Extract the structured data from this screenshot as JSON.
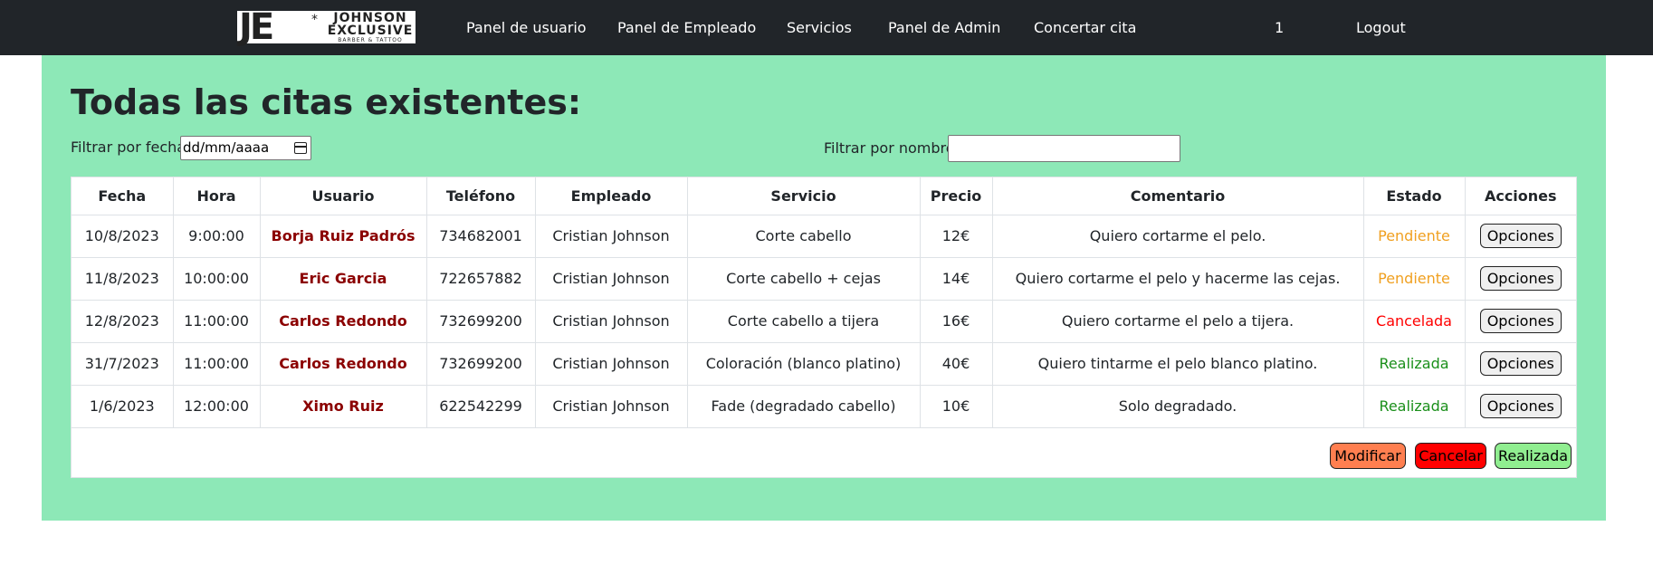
{
  "nav": {
    "logo_mark": "JE",
    "logo_star": "*",
    "logo_line1": "JOHNSON",
    "logo_line2": "EXCLUSIVE",
    "logo_line3": "BARBER & TATTOO",
    "links": [
      "Panel de usuario",
      "Panel de Empleado",
      "Servicios",
      "Panel de Admin",
      "Concertar cita"
    ],
    "user_id": "1",
    "logout": "Logout"
  },
  "page": {
    "title": "Todas las citas existentes:",
    "filter_date_label": "Filtrar por fecha:",
    "filter_date_value": "dd/mm/aaaa",
    "filter_name_label": "Filtrar por nombre:",
    "filter_name_value": ""
  },
  "table": {
    "headers": [
      "Fecha",
      "Hora",
      "Usuario",
      "Teléfono",
      "Empleado",
      "Servicio",
      "Precio",
      "Comentario",
      "Estado",
      "Acciones"
    ],
    "rows": [
      {
        "fecha": "10/8/2023",
        "hora": "9:00:00",
        "usuario": "Borja Ruiz Padrós",
        "telefono": "734682001",
        "empleado": "Cristian Johnson",
        "servicio": "Corte cabello",
        "precio": "12€",
        "comentario": "Quiero cortarme el pelo.",
        "estado": "Pendiente",
        "accion": "Opciones"
      },
      {
        "fecha": "11/8/2023",
        "hora": "10:00:00",
        "usuario": "Eric Garcia",
        "telefono": "722657882",
        "empleado": "Cristian Johnson",
        "servicio": "Corte cabello + cejas",
        "precio": "14€",
        "comentario": "Quiero cortarme el pelo y hacerme las cejas.",
        "estado": "Pendiente",
        "accion": "Opciones"
      },
      {
        "fecha": "12/8/2023",
        "hora": "11:00:00",
        "usuario": "Carlos Redondo",
        "telefono": "732699200",
        "empleado": "Cristian Johnson",
        "servicio": "Corte cabello a tijera",
        "precio": "16€",
        "comentario": "Quiero cortarme el pelo a tijera.",
        "estado": "Cancelada",
        "accion": "Opciones"
      },
      {
        "fecha": "31/7/2023",
        "hora": "11:00:00",
        "usuario": "Carlos Redondo",
        "telefono": "732699200",
        "empleado": "Cristian Johnson",
        "servicio": "Coloración (blanco platino)",
        "precio": "40€",
        "comentario": "Quiero tintarme el pelo blanco platino.",
        "estado": "Realizada",
        "accion": "Opciones"
      },
      {
        "fecha": "1/6/2023",
        "hora": "12:00:00",
        "usuario": "Ximo Ruiz",
        "telefono": "622542299",
        "empleado": "Cristian Johnson",
        "servicio": "Fade (degradado cabello)",
        "precio": "10€",
        "comentario": "Solo degradado.",
        "estado": "Realizada",
        "accion": "Opciones"
      }
    ]
  },
  "actions": {
    "modificar": "Modificar",
    "cancelar": "Cancelar",
    "realizada": "Realizada"
  },
  "colors": {
    "navbar": "#212529",
    "panel": "#8de8b7",
    "usuario": "#8b0000",
    "pendiente": "#f0a020",
    "cancelada": "#ff0000",
    "realizada": "#1a8f1a",
    "btn_modificar": "#ff7f50",
    "btn_cancelar": "#ff0000",
    "btn_realizada": "#90ee90"
  }
}
